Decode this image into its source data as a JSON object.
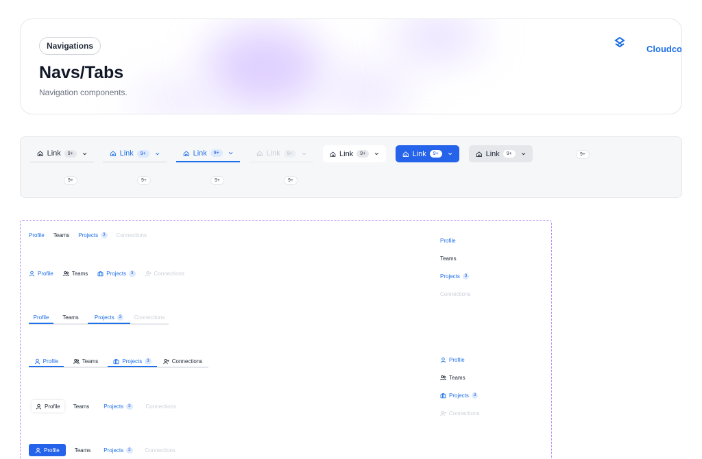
{
  "header": {
    "chip": "Navigations",
    "title": "Navs/Tabs",
    "subtitle": "Navigation components.",
    "brand": "Cloudcon",
    "brand_icon": "cloudcon-logo-icon"
  },
  "links": {
    "label": "Link",
    "badge": "9+",
    "home_icon": "home-icon",
    "chevron_icon": "chevron-down-icon",
    "lone_badges": [
      "9+",
      "9+",
      "9+",
      "9+",
      "9+"
    ]
  },
  "tabs": {
    "profile": "Profile",
    "teams": "Teams",
    "projects": "Projects",
    "projects_count": "3",
    "connections": "Connections"
  },
  "colors": {
    "accent": "#1d6fe8",
    "primary_button": "#2563eb",
    "dashed_border": "#b58cf5"
  }
}
